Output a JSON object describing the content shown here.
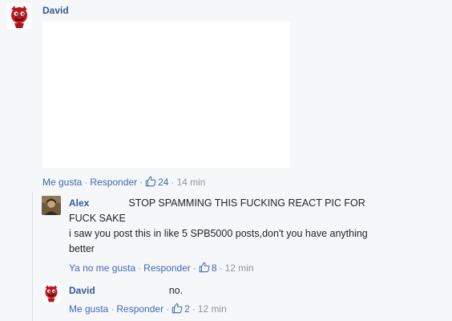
{
  "comment1": {
    "author": "David",
    "actions": {
      "like": "Me gusta",
      "reply": "Responder",
      "likes_count": "24",
      "time": "14 min"
    }
  },
  "reply1": {
    "author": "Alex",
    "text_line1": "STOP SPAMMING THIS FUCKING REACT PIC FOR",
    "text_line2": "FUCK SAKE",
    "text_line3": "i saw you post this in like 5 SPB5000 posts,don't you have anything",
    "text_line4": "better",
    "actions": {
      "unlike": "Ya no me gusta",
      "reply": "Responder",
      "likes_count": "8",
      "time": "12 min"
    }
  },
  "reply2": {
    "author": "David",
    "text": "no.",
    "actions": {
      "like": "Me gusta",
      "reply": "Responder",
      "likes_count": "2",
      "time": "12 min"
    }
  },
  "icons": {
    "avatar_david": "devil-avatar-icon",
    "avatar_alex": "profile-photo-icon",
    "like": "thumbs-up-icon"
  },
  "colors": {
    "name": "#365899",
    "link": "#4267b2",
    "meta": "#90949c",
    "background": "#f6f7f9"
  }
}
